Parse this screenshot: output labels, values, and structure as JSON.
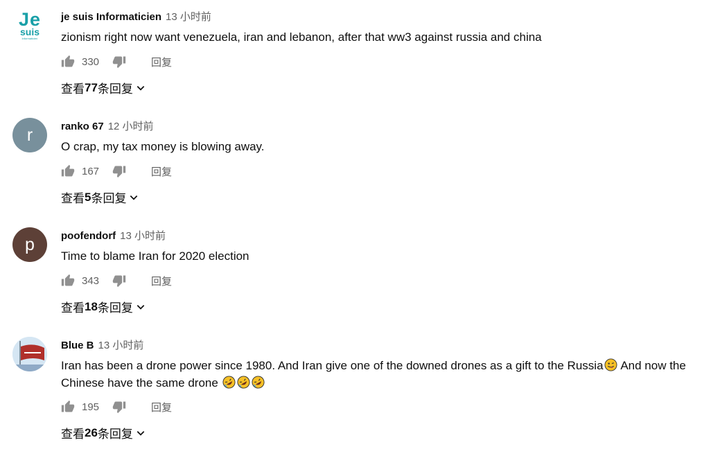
{
  "comments": [
    {
      "author": "je suis Informaticien",
      "time": "13 小时前",
      "text": "zionism right now want venezuela, iran and lebanon, after that ww3 against russia and china",
      "avatar": {
        "type": "logo",
        "line1": "Je",
        "line2": "suis",
        "line3": "informaticien",
        "color": "#1aa0a8"
      },
      "likes": "330",
      "reply_label": "回复",
      "view_replies": {
        "prefix": "查看",
        "count": "77",
        "suffix": " 条回复"
      }
    },
    {
      "author": "ranko 67",
      "time": "12 小时前",
      "text": "O crap, my tax money is blowing away.",
      "avatar": {
        "type": "letter",
        "letter": "r",
        "color": "#78909c"
      },
      "likes": "167",
      "reply_label": "回复",
      "view_replies": {
        "prefix": "查看",
        "count": "5",
        "suffix": " 条回复"
      }
    },
    {
      "author": "poofendorf",
      "time": "13 小时前",
      "text": "Time to blame Iran for 2020 election",
      "avatar": {
        "type": "letter",
        "letter": "p",
        "color": "#5d4037"
      },
      "likes": "343",
      "reply_label": "回复",
      "view_replies": {
        "prefix": "查看",
        "count": "18",
        "suffix": " 条回复"
      }
    },
    {
      "author": "Blue B",
      "time": "13 小时前",
      "text_part1": "Iran has been a drone power since 1980. And Iran give one of the downed drones as a gift to the Russia",
      "text_part2": " And now the Chinese have the same drone ",
      "emoji_after_part1": "tongue-wink-emoji",
      "emoji_after_part2": [
        "rofl-emoji",
        "rofl-emoji",
        "rofl-emoji"
      ],
      "avatar": {
        "type": "image",
        "description": "flag"
      },
      "likes": "195",
      "reply_label": "回复",
      "view_replies": {
        "prefix": "查看",
        "count": "26",
        "suffix": " 条回复"
      }
    }
  ],
  "icons": {
    "like": "thumbs-up-icon",
    "dislike": "thumbs-down-icon",
    "expand": "chevron-down-icon"
  },
  "colors": {
    "text": "#0f0f0f",
    "secondary": "#606060",
    "icon": "#909090"
  }
}
